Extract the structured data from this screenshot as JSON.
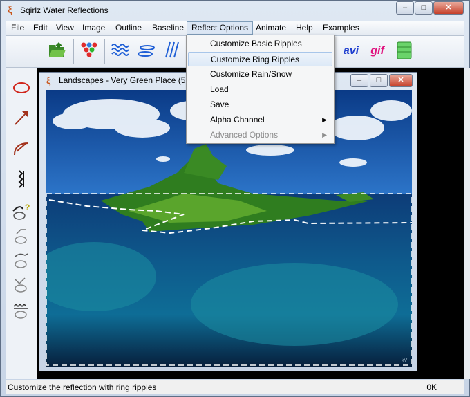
{
  "window": {
    "title": "Sqirlz Water Reflections",
    "minimize": "–",
    "maximize": "□",
    "close": "✕"
  },
  "menubar": {
    "items": [
      "File",
      "Edit",
      "View",
      "Image",
      "Outline",
      "Baseline",
      "Reflect Options",
      "Animate",
      "Help",
      "Examples"
    ]
  },
  "toolbar": {
    "avi_label": "avi",
    "gif_label": "gif"
  },
  "child_window": {
    "title": "Landscapes - Very Green Place  (52%"
  },
  "dropdown": {
    "items": [
      {
        "label": "Customize Basic Ripples"
      },
      {
        "label": "Customize Ring Ripples"
      },
      {
        "label": "Customize Rain/Snow"
      },
      {
        "label": "Load"
      },
      {
        "label": "Save"
      },
      {
        "label": "Alpha Channel",
        "arrow": "▶"
      },
      {
        "label": "Advanced Options",
        "arrow": "▶"
      }
    ]
  },
  "image": {
    "watermark": "kV"
  },
  "statusbar": {
    "text": "Customize the reflection with ring ripples",
    "status": "0K"
  },
  "colors": {
    "accent": "#c9571d",
    "avi": "#1f3fcf",
    "gif": "#e0147f",
    "highlight": "#dde9f7"
  }
}
